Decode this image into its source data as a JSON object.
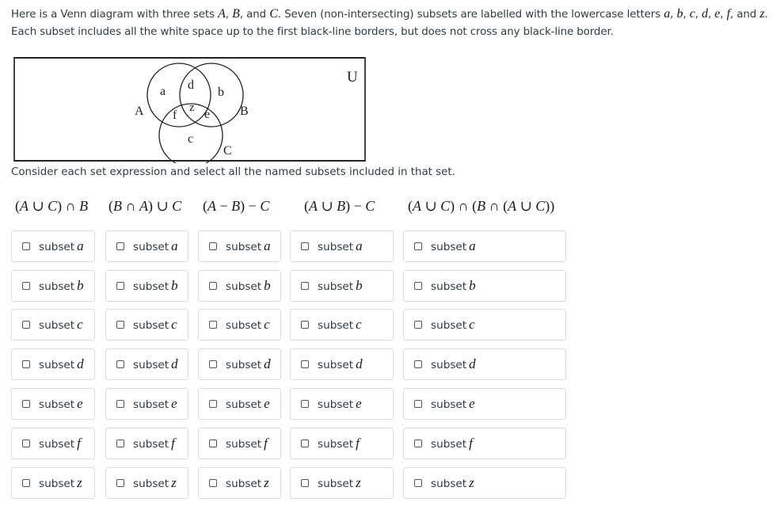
{
  "intro": {
    "line1_parts": [
      "Here is a Venn diagram with three sets ",
      "A",
      ", ",
      "B",
      ", and ",
      "C",
      ". Seven (non-intersecting) subsets are labelled with the lowercase letters ",
      "a",
      ", ",
      "b",
      ", ",
      "c",
      ", ",
      "d",
      ", ",
      "e",
      ", ",
      "f",
      ", and ",
      "z",
      "."
    ],
    "line2": "Each subset includes all the white space up to the first black-line borders, but does not cross any black-line border."
  },
  "diagram": {
    "universe_label": "U",
    "set_labels": {
      "A": "A",
      "B": "B",
      "C": "C"
    },
    "region_labels": {
      "a": "a",
      "b": "b",
      "c": "c",
      "d": "d",
      "e": "e",
      "f": "f",
      "z": "z"
    },
    "regions": {
      "a": "A only",
      "b": "B only",
      "c": "C only",
      "d": "A ∩ B only",
      "e": "B ∩ C only",
      "f": "A ∩ C only",
      "z": "A ∩ B ∩ C"
    }
  },
  "prompt": "Consider each set expression and select all the named subsets included in that set.",
  "questions": [
    {
      "expression": "(A ∪ C) ∩ B",
      "options": [
        {
          "label": "subset",
          "var": "a",
          "checked": false
        },
        {
          "label": "subset",
          "var": "b",
          "checked": false
        },
        {
          "label": "subset",
          "var": "c",
          "checked": false
        },
        {
          "label": "subset",
          "var": "d",
          "checked": false
        },
        {
          "label": "subset",
          "var": "e",
          "checked": false
        },
        {
          "label": "subset",
          "var": "f",
          "checked": false
        },
        {
          "label": "subset",
          "var": "z",
          "checked": false
        }
      ]
    },
    {
      "expression": "(B ∩ A) ∪ C",
      "options": [
        {
          "label": "subset",
          "var": "a",
          "checked": false
        },
        {
          "label": "subset",
          "var": "b",
          "checked": false
        },
        {
          "label": "subset",
          "var": "c",
          "checked": false
        },
        {
          "label": "subset",
          "var": "d",
          "checked": false
        },
        {
          "label": "subset",
          "var": "e",
          "checked": false
        },
        {
          "label": "subset",
          "var": "f",
          "checked": false
        },
        {
          "label": "subset",
          "var": "z",
          "checked": false
        }
      ]
    },
    {
      "expression": "(A − B) − C",
      "options": [
        {
          "label": "subset",
          "var": "a",
          "checked": false
        },
        {
          "label": "subset",
          "var": "b",
          "checked": false
        },
        {
          "label": "subset",
          "var": "c",
          "checked": false
        },
        {
          "label": "subset",
          "var": "d",
          "checked": false
        },
        {
          "label": "subset",
          "var": "e",
          "checked": false
        },
        {
          "label": "subset",
          "var": "f",
          "checked": false
        },
        {
          "label": "subset",
          "var": "z",
          "checked": false
        }
      ]
    },
    {
      "expression": "(A ∪ B) − C",
      "options": [
        {
          "label": "subset",
          "var": "a",
          "checked": false
        },
        {
          "label": "subset",
          "var": "b",
          "checked": false
        },
        {
          "label": "subset",
          "var": "c",
          "checked": false
        },
        {
          "label": "subset",
          "var": "d",
          "checked": false
        },
        {
          "label": "subset",
          "var": "e",
          "checked": false
        },
        {
          "label": "subset",
          "var": "f",
          "checked": false
        },
        {
          "label": "subset",
          "var": "z",
          "checked": false
        }
      ]
    },
    {
      "expression": "(A ∪ C) ∩ (B ∩ (A ∪ C))",
      "options": [
        {
          "label": "subset",
          "var": "a",
          "checked": false
        },
        {
          "label": "subset",
          "var": "b",
          "checked": false
        },
        {
          "label": "subset",
          "var": "c",
          "checked": false
        },
        {
          "label": "subset",
          "var": "d",
          "checked": false
        },
        {
          "label": "subset",
          "var": "e",
          "checked": false
        },
        {
          "label": "subset",
          "var": "f",
          "checked": false
        },
        {
          "label": "subset",
          "var": "z",
          "checked": false
        }
      ]
    }
  ]
}
